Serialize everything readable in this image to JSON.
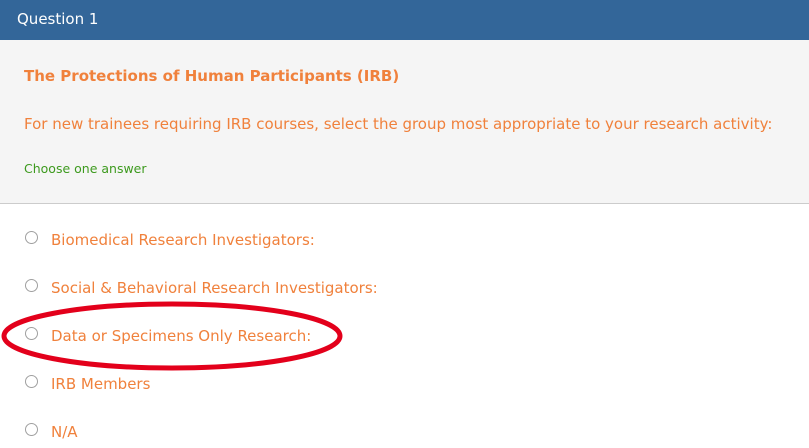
{
  "header": {
    "title": "Question 1"
  },
  "question": {
    "title": "The Protections of Human Participants (IRB)",
    "text": "For new trainees requiring IRB courses, select the group most appropriate to your research activity:",
    "hint": "Choose one answer"
  },
  "options": [
    {
      "label": "Biomedical Research Investigators:",
      "selected": false
    },
    {
      "label": "Social & Behavioral Research Investigators:",
      "selected": false
    },
    {
      "label": "Data or Specimens Only Research:",
      "selected": false
    },
    {
      "label": "IRB Members",
      "selected": false
    },
    {
      "label": "N/A",
      "selected": false
    }
  ],
  "annotation": {
    "shape": "ellipse",
    "color": "#e3001b",
    "highlights": "Data or Specimens Only Research:"
  },
  "colors": {
    "header_bg": "#336699",
    "panel_bg": "#f5f5f5",
    "accent_orange": "#f0813c",
    "hint_green": "#3d9a1e"
  }
}
